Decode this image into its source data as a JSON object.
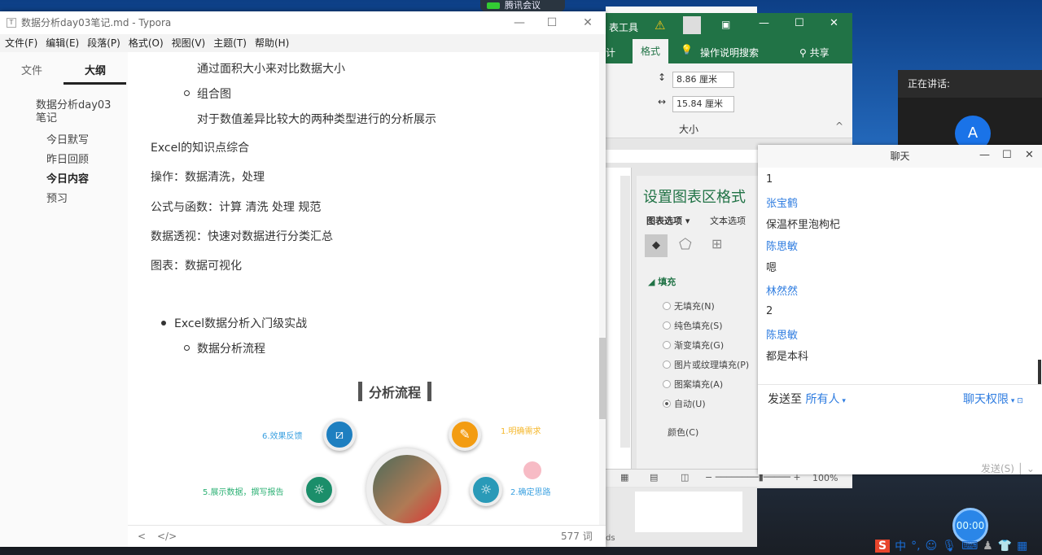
{
  "meeting": {
    "label": "腾讯会议"
  },
  "typora": {
    "title": "数据分析day03笔记.md - Typora",
    "menu": [
      "文件(F)",
      "编辑(E)",
      "段落(P)",
      "格式(O)",
      "视图(V)",
      "主题(T)",
      "帮助(H)"
    ],
    "tabs": [
      "文件",
      "大纲"
    ],
    "outline": {
      "root": "数据分析day03笔记",
      "items": [
        "今日默写",
        "昨日回顾",
        "今日内容",
        "预习"
      ]
    },
    "content": {
      "l1": "通过面积大小来对比数据大小",
      "l2": "组合图",
      "l3": "对于数值差异比较大的两种类型进行的分析展示",
      "l4": "Excel的知识点综合",
      "l5": "操作：数据清洗，处理",
      "l6": "公式与函数：计算 清洗 处理 规范",
      "l7": "数据透视：快速对数据进行分类汇总",
      "l8": "图表：数据可视化",
      "l9": "Excel数据分析入门级实战",
      "l10": "数据分析流程"
    },
    "diagram": {
      "title": "分析流程",
      "steps": [
        "1.明确需求",
        "2.确定思路",
        "5.展示数据，撰写报告",
        "6.效果反馈"
      ]
    },
    "footer": {
      "back": "<",
      "source": "</>",
      "words": "577 词"
    }
  },
  "excel": {
    "title": "表工具",
    "tabs": [
      "计",
      "格式"
    ],
    "search": "操作说明搜索",
    "share": "共享",
    "height": "8.86 厘米",
    "width": "15.84 厘米",
    "group": "大小",
    "pane": {
      "title": "设置图表区格式",
      "tab1": "图表选项",
      "tab2": "文本选项",
      "section": "填充",
      "options": [
        "无填充(N)",
        "纯色填充(S)",
        "渐变填充(G)",
        "图片或纹理填充(P)",
        "图案填充(A)",
        "自动(U)"
      ],
      "color": "颜色(C)"
    },
    "zoom": "100%",
    "sheet": "ds"
  },
  "speaker": {
    "label": "正在讲话:",
    "avatar": "A"
  },
  "chat": {
    "title": "聊天",
    "messages": [
      {
        "text": "1"
      },
      {
        "name": "张宝鹤",
        "text": "保温杯里泡枸杞"
      },
      {
        "name": "陈思敏",
        "text": "嗯"
      },
      {
        "name": "林然然",
        "text": "2"
      },
      {
        "name": "陈思敏",
        "text": "都是本科"
      }
    ],
    "send_to": "发送至",
    "recipient": "所有人",
    "permission": "聊天权限",
    "send": "发送(S)"
  },
  "timer": "00:00",
  "ime": {
    "lang": "中"
  }
}
